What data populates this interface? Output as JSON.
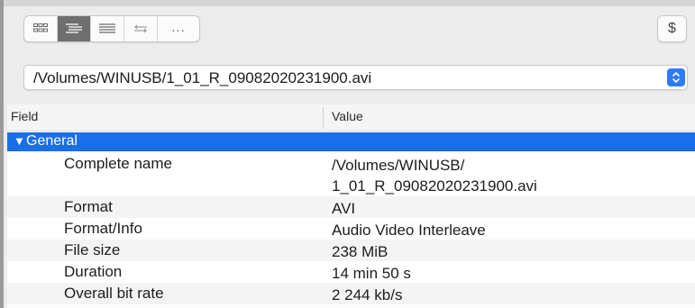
{
  "toolbar": {
    "buttons": [
      {
        "icon": "grid-view-icon",
        "active": false
      },
      {
        "icon": "list-tree-view-icon",
        "active": true
      },
      {
        "icon": "text-view-icon",
        "active": false
      },
      {
        "icon": "compare-arrows-icon",
        "active": false
      },
      {
        "icon": "more-icon",
        "label": "..."
      }
    ],
    "dollar_label": "$"
  },
  "file_select": {
    "value": "/Volumes/WINUSB/1_01_R_09082020231900.avi"
  },
  "table": {
    "headers": {
      "field": "Field",
      "value": "Value"
    },
    "group": {
      "label": "General",
      "expanded": true
    },
    "rows": [
      {
        "field": "Complete name",
        "value_line1": "/Volumes/WINUSB/",
        "value_line2": "1_01_R_09082020231900.avi"
      },
      {
        "field": "Format",
        "value": "AVI"
      },
      {
        "field": "Format/Info",
        "value": "Audio Video Interleave"
      },
      {
        "field": "File size",
        "value": "238 MiB"
      },
      {
        "field": "Duration",
        "value": "14 min 50 s"
      },
      {
        "field": "Overall bit rate",
        "value": "2 244 kb/s"
      }
    ]
  },
  "colors": {
    "accent": "#1a6ee8",
    "select_arrow_bg": "#2f7bf6",
    "active_toolbar_button": "#6f6f6f"
  }
}
